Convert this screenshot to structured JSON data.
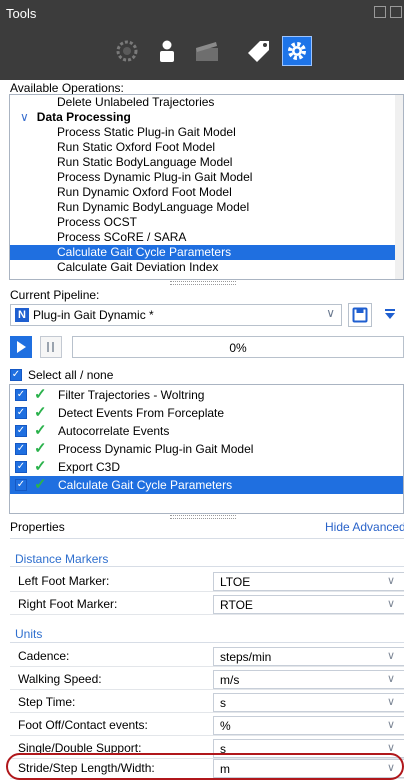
{
  "panel": {
    "title": "Tools"
  },
  "toolbar": {
    "icons": [
      "gear-outline-icon",
      "person-icon",
      "clapper-icon",
      "tag-icon",
      "gear-icon"
    ],
    "active_index": 4
  },
  "available_operations": {
    "label": "Available Operations:",
    "items": [
      {
        "text": "Delete Unlabeled Trajectories",
        "type": "item"
      },
      {
        "text": "Data Processing",
        "type": "category"
      },
      {
        "text": "Process Static Plug-in Gait Model",
        "type": "item"
      },
      {
        "text": "Run Static Oxford Foot Model",
        "type": "item"
      },
      {
        "text": "Run Static BodyLanguage Model",
        "type": "item"
      },
      {
        "text": "Process Dynamic Plug-in Gait Model",
        "type": "item"
      },
      {
        "text": "Run Dynamic Oxford Foot Model",
        "type": "item"
      },
      {
        "text": "Run Dynamic BodyLanguage Model",
        "type": "item"
      },
      {
        "text": "Process OCST",
        "type": "item"
      },
      {
        "text": "Process SCoRE / SARA",
        "type": "item"
      },
      {
        "text": "Calculate Gait Cycle Parameters",
        "type": "item",
        "selected": true
      },
      {
        "text": "Calculate Gait Deviation Index",
        "type": "item"
      }
    ]
  },
  "pipeline": {
    "label": "Current Pipeline:",
    "selected": "Plug-in Gait Dynamic *",
    "icon_letter": "N",
    "progress_text": "0%",
    "progress_fraction": 0,
    "select_all_label": "Select all / none",
    "steps": [
      {
        "text": "Filter Trajectories - Woltring",
        "selected": false
      },
      {
        "text": "Detect Events From Forceplate",
        "selected": false
      },
      {
        "text": "Autocorrelate Events",
        "selected": false
      },
      {
        "text": "Process Dynamic Plug-in Gait Model",
        "selected": false
      },
      {
        "text": "Export C3D",
        "selected": false
      },
      {
        "text": "Calculate Gait Cycle Parameters",
        "selected": true
      }
    ]
  },
  "properties": {
    "label": "Properties",
    "hide_advanced": "Hide Advanced",
    "groups": {
      "distance_markers": {
        "title": "Distance Markers",
        "rows": [
          {
            "label": "Left Foot Marker:",
            "value": "LTOE"
          },
          {
            "label": "Right Foot Marker:",
            "value": "RTOE"
          }
        ]
      },
      "units": {
        "title": "Units",
        "rows": [
          {
            "label": "Cadence:",
            "value": "steps/min"
          },
          {
            "label": "Walking Speed:",
            "value": "m/s"
          },
          {
            "label": "Step Time:",
            "value": "s"
          },
          {
            "label": "Foot Off/Contact events:",
            "value": "%"
          },
          {
            "label": "Single/Double Support:",
            "value": "s"
          },
          {
            "label": "Stride/Step Length/Width:",
            "value": "m"
          }
        ]
      }
    }
  },
  "colors": {
    "accent": "#1f6fe0",
    "group_title": "#2f6fce",
    "highlight": "#b0171b",
    "check": "#2bb24c",
    "titlebar": "#3c3c3c"
  }
}
